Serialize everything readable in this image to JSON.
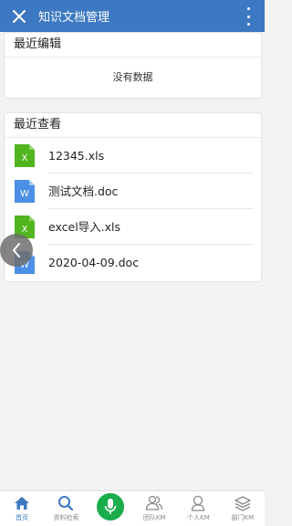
{
  "header": {
    "title": "知识文档管理"
  },
  "recent_edit": {
    "title": "最近编辑",
    "empty_text": "没有数据"
  },
  "recent_view": {
    "title": "最近查看",
    "files": [
      {
        "name": "12345.xls",
        "type": "excel",
        "letter": "X"
      },
      {
        "name": "测试文档.doc",
        "type": "word",
        "letter": "W"
      },
      {
        "name": "excel导入.xls",
        "type": "excel",
        "letter": "X"
      },
      {
        "name": "2020-04-09.doc",
        "type": "word",
        "letter": "W"
      }
    ]
  },
  "tabs": [
    {
      "label": "首页",
      "icon": "home-icon",
      "active": true
    },
    {
      "label": "资料检索",
      "icon": "search-icon",
      "active": false
    },
    {
      "label": "",
      "icon": "microphone-icon",
      "active": false
    },
    {
      "label": "团队KM",
      "icon": "team-icon",
      "active": false
    },
    {
      "label": "个人KM",
      "icon": "person-icon",
      "active": false
    },
    {
      "label": "部门KM",
      "icon": "layers-icon",
      "active": false
    }
  ],
  "colors": {
    "header": "#3d78c2",
    "excel": "#52b51f",
    "word": "#4b8fe6",
    "voice": "#1aad4b",
    "active_tab": "#3d78c2"
  }
}
